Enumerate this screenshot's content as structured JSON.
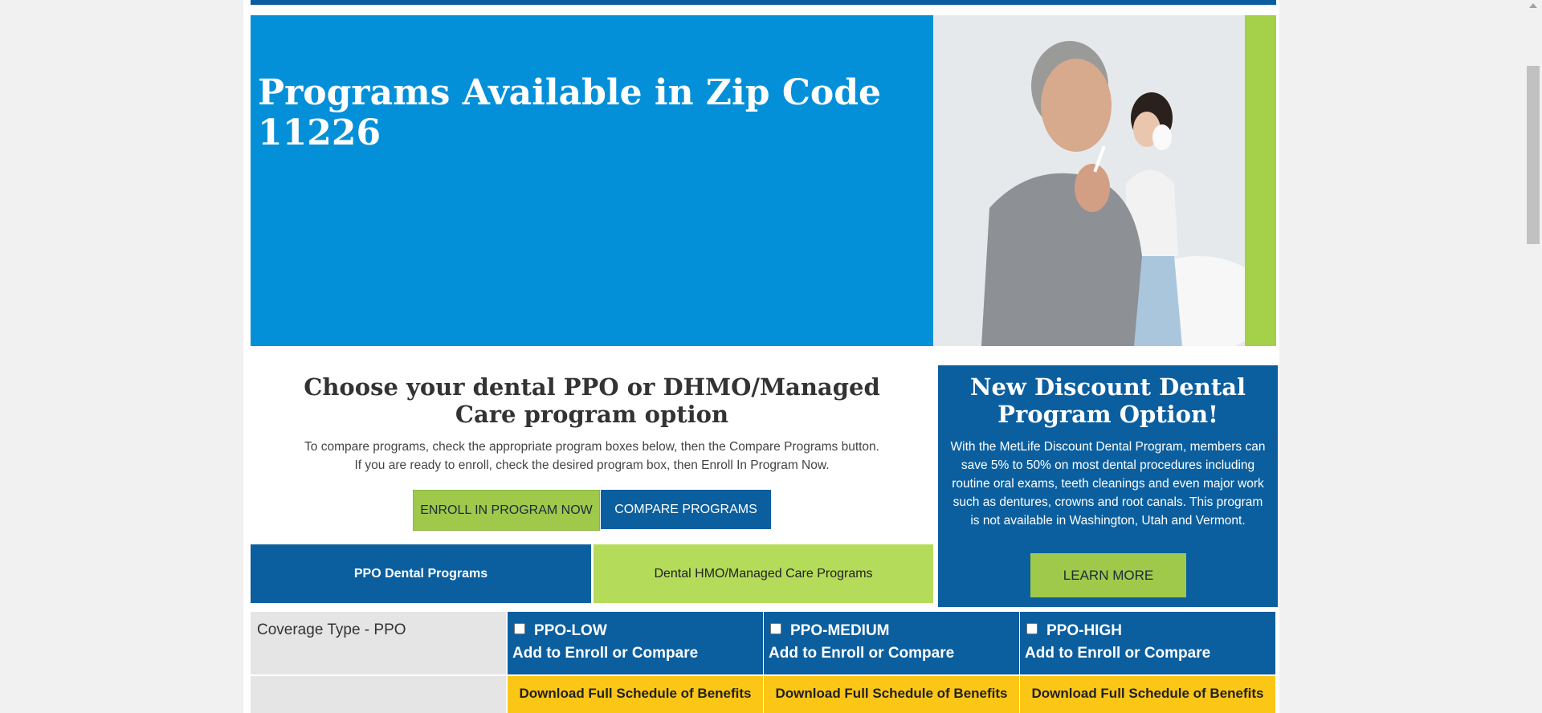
{
  "hero": {
    "title": "Programs Available in Zip Code 11226"
  },
  "choose": {
    "title": "Choose your dental PPO or DHMO/Managed Care program option",
    "instruction_line1": "To compare programs, check the appropriate program boxes below, then the Compare Programs button.",
    "instruction_line2": "If you are ready to enroll, check the desired program box, then Enroll In Program Now.",
    "enroll_button": "ENROLL IN PROGRAM NOW",
    "compare_button": "COMPARE PROGRAMS"
  },
  "tabs": {
    "ppo": "PPO Dental Programs",
    "dhmo": "Dental HMO/Managed Care Programs"
  },
  "promo": {
    "title": "New Discount Dental Program Option!",
    "text": "With the MetLife Discount Dental Program, members can save 5% to 50% on most dental procedures including routine oral exams, teeth cleanings and even major work such as dentures, crowns and root canals. This program is not available in Washington, Utah and Vermont.",
    "button": "LEARN MORE"
  },
  "table": {
    "coverage_label": "Coverage Type - PPO",
    "plans": [
      {
        "name": "PPO-LOW",
        "sub": "Add to Enroll or Compare",
        "download": "Download Full Schedule of Benefits",
        "checked": false
      },
      {
        "name": "PPO-MEDIUM",
        "sub": "Add to Enroll or Compare",
        "download": "Download Full Schedule of Benefits",
        "checked": false
      },
      {
        "name": "PPO-HIGH",
        "sub": "Add to Enroll or Compare",
        "download": "Download Full Schedule of Benefits",
        "checked": false
      }
    ]
  },
  "colors": {
    "primary_blue": "#0b5f9f",
    "hero_blue": "#0490d9",
    "green": "#9fc94b",
    "yellow": "#fcc617"
  }
}
